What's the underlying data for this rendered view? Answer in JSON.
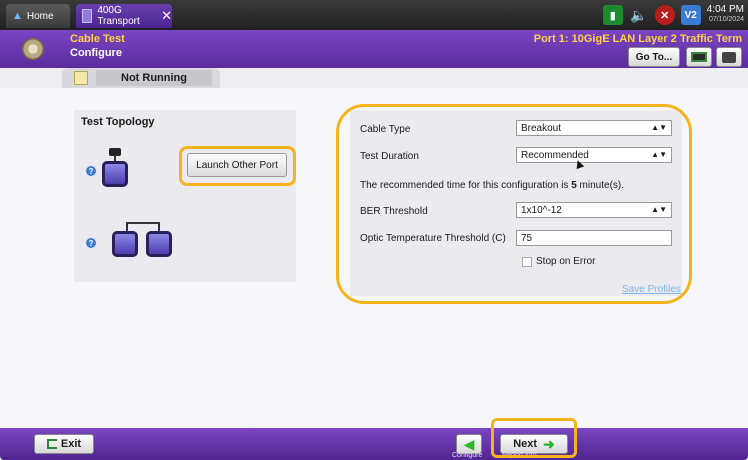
{
  "tabs": {
    "home_label": "Home",
    "app_label": "400G Transport",
    "close_glyph": "✕"
  },
  "tray": {
    "v2_label": "V2",
    "time": "4:04 PM",
    "date": "07/10/2024"
  },
  "header": {
    "title": "Cable Test",
    "subtitle": "Configure",
    "port": "Port 1: 10GigE LAN Layer 2 Traffic Term",
    "goto_label": "Go To..."
  },
  "status": {
    "label": "Not Running"
  },
  "topology": {
    "title": "Test Topology",
    "launch_label": "Launch Other Port"
  },
  "config": {
    "cable_type_label": "Cable Type",
    "cable_type_value": "Breakout",
    "test_duration_label": "Test Duration",
    "test_duration_value": "Recommended",
    "note_prefix": "The recommended time for this configuration is ",
    "note_value": "5",
    "note_suffix": " minute(s).",
    "ber_label": "BER Threshold",
    "ber_value": "1x10^-12",
    "optic_label": "Optic Temperature Threshold (C)",
    "optic_value": "75",
    "stop_label": "Stop on Error",
    "save_profiles": "Save Profiles"
  },
  "footer": {
    "exit_label": "Exit",
    "back_caption": "Configure",
    "next_label": "Next",
    "next_caption": "Report Info"
  },
  "colors": {
    "accent_purple": "#5a2c9e",
    "highlight": "#f5b31e",
    "header_text": "#ffd23f"
  }
}
